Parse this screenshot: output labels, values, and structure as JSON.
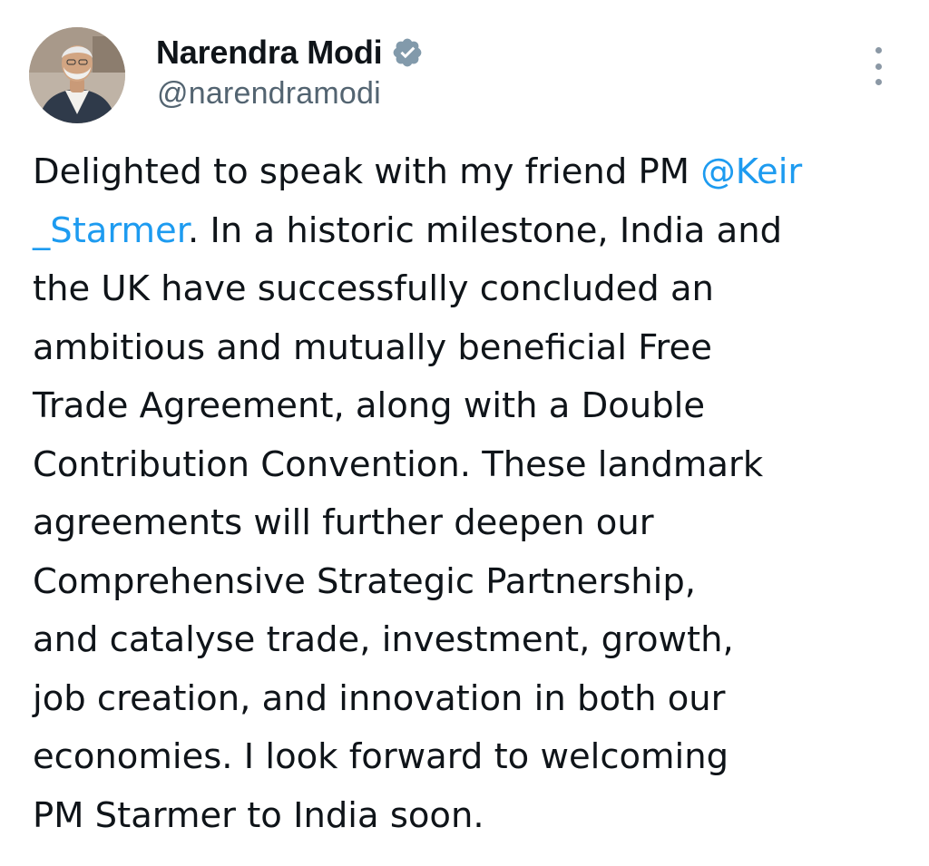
{
  "author": {
    "display_name": "Narendra Modi",
    "handle": "@narendramodi",
    "verified": true,
    "avatar_icon": "profile-photo"
  },
  "menu": {
    "icon": "more-vertical-icon"
  },
  "colors": {
    "text": "#0f1419",
    "secondary": "#536471",
    "link": "#1d9bf0",
    "verified_badge": "#829aab"
  },
  "tweet": {
    "lines": [
      [
        {
          "text": "Delighted to speak with my friend PM "
        },
        {
          "text": "@Keir",
          "mention": true
        }
      ],
      [
        {
          "text": "_Starmer",
          "mention": true
        },
        {
          "text": ". In a historic milestone, India and"
        }
      ],
      [
        {
          "text": "the UK have successfully concluded an"
        }
      ],
      [
        {
          "text": "ambitious and mutually beneficial Free"
        }
      ],
      [
        {
          "text": "Trade Agreement, along with a Double"
        }
      ],
      [
        {
          "text": "Contribution Convention. These landmark"
        }
      ],
      [
        {
          "text": "agreements will further deepen our"
        }
      ],
      [
        {
          "text": "Comprehensive Strategic Partnership,"
        }
      ],
      [
        {
          "text": "and catalyse trade, investment, growth,"
        }
      ],
      [
        {
          "text": "job creation, and innovation in both our"
        }
      ],
      [
        {
          "text": "economies. I look forward to welcoming"
        }
      ],
      [
        {
          "text": "PM Starmer to India soon."
        }
      ]
    ]
  }
}
